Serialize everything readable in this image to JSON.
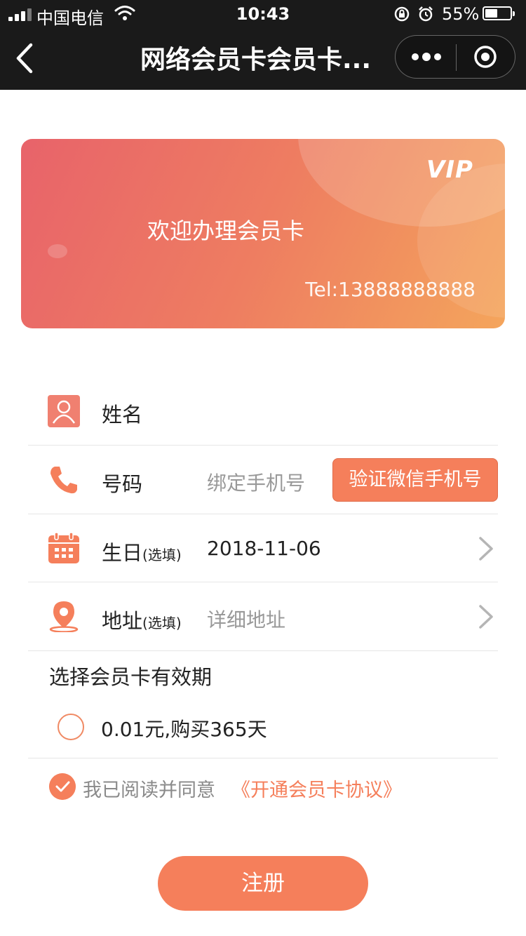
{
  "status_bar": {
    "carrier": "中国电信",
    "time": "10:43",
    "battery_percent": "55%",
    "battery_level": 0.55,
    "icons": [
      "signal-icon",
      "wifi-icon",
      "rotation-lock-icon",
      "alarm-icon",
      "battery-icon"
    ]
  },
  "nav": {
    "title": "网络会员卡会员卡...",
    "icons": [
      "back-icon",
      "more-icon",
      "target-icon"
    ]
  },
  "card": {
    "vip": "VIP",
    "welcome": "欢迎办理会员卡",
    "tel": "Tel:13888888888"
  },
  "form": {
    "name": {
      "label": "姓名",
      "value": "",
      "icon": "user-icon"
    },
    "phone": {
      "label": "号码",
      "placeholder": "绑定手机号",
      "button": "验证微信手机号",
      "icon": "phone-icon"
    },
    "birthday": {
      "label": "生日",
      "optional": "(选填)",
      "value": "2018-11-06",
      "icon": "calendar-icon"
    },
    "address": {
      "label": "地址",
      "optional": "(选填)",
      "placeholder": "详细地址",
      "icon": "location-pin-icon"
    }
  },
  "validity": {
    "title": "选择会员卡有效期",
    "option": "0.01元,购买365天"
  },
  "agreement": {
    "text": "我已阅读并同意",
    "link": "《开通会员卡协议》",
    "checked": true
  },
  "submit": {
    "label": "注册"
  },
  "colors": {
    "accent": "#f57f5b",
    "nav_bg": "#1a1a1a",
    "card_gradient": [
      "#e8636a",
      "#f4a55c"
    ]
  }
}
